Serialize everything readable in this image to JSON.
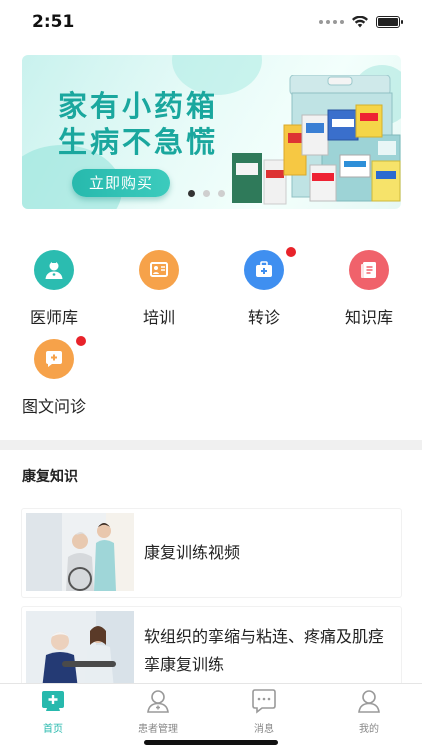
{
  "status_bar": {
    "time": "2:51"
  },
  "banner": {
    "title_line1": "家有小药箱",
    "title_line2": "生病不急慌",
    "button_label": "立即购买",
    "slide_count": 3,
    "active_slide": 1
  },
  "grid": [
    {
      "label": "医师库",
      "icon": "doctor-icon",
      "color": "#2bbcb0",
      "badge": false
    },
    {
      "label": "培训",
      "icon": "training-icon",
      "color": "#f6a24a",
      "badge": false
    },
    {
      "label": "转诊",
      "icon": "referral-icon",
      "color": "#3f8ff0",
      "badge": true
    },
    {
      "label": "知识库",
      "icon": "knowledge-icon",
      "color": "#f0626b",
      "badge": false
    },
    {
      "label": "图文问诊",
      "icon": "chat-consult-icon",
      "color": "#f6a24a",
      "badge": true
    }
  ],
  "section": {
    "title": "康复知识"
  },
  "articles": [
    {
      "title": "康复训练视频"
    },
    {
      "title_line1": "软组织的挛缩与粘连、疼痛及肌痉",
      "title_line2": "挛康复训练"
    }
  ],
  "tabbar": [
    {
      "label": "首页",
      "icon": "home-icon",
      "active": true
    },
    {
      "label": "患者管理",
      "icon": "patient-icon",
      "active": false
    },
    {
      "label": "消息",
      "icon": "message-icon",
      "active": false
    },
    {
      "label": "我的",
      "icon": "profile-icon",
      "active": false
    }
  ],
  "colors": {
    "accent": "#27b9ad",
    "badge": "#e8232a",
    "banner_text": "#1aa79e"
  }
}
